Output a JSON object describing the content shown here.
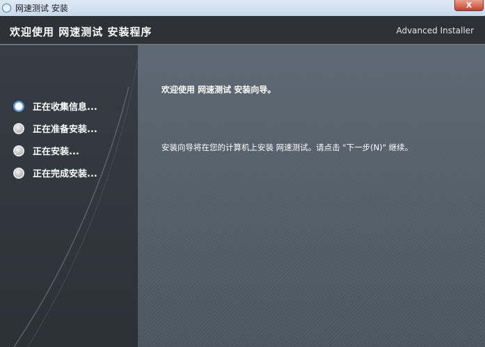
{
  "window": {
    "title": "网速测试 安装",
    "close_label": "X"
  },
  "header": {
    "title": "欢迎使用 网速测试 安装程序",
    "brand": "Advanced Installer"
  },
  "steps": [
    {
      "label": "正在收集信息...",
      "active": true
    },
    {
      "label": "正在准备安装...",
      "active": false
    },
    {
      "label": "正在安装...",
      "active": false
    },
    {
      "label": "正在完成安装...",
      "active": false
    }
  ],
  "main": {
    "welcome": "欢迎使用 网速测试 安装向导。",
    "description": "安装向导将在您的计算机上安装 网速测试。请点击 \"下一步(N)\" 继续。"
  }
}
